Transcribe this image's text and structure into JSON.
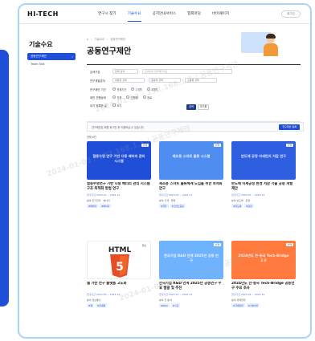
{
  "header": {
    "logo": "HI-TECH",
    "nav": [
      "연구시 찾기",
      "기술수요",
      "공지안내서비스",
      "협회마당",
      "바이패이지"
    ],
    "active_index": 1,
    "right_button": "로그인"
  },
  "sidebar": {
    "title": "기술수요",
    "items": [
      {
        "label": "공동연구제안"
      },
      {
        "label": "Team Talk"
      }
    ]
  },
  "breadcrumb": [
    "기술수요",
    "공동연구제안"
  ],
  "page_title": "공동연구제안",
  "search": {
    "rows": [
      {
        "label": "검색구분",
        "select": "전체 검색",
        "input_placeholder": "검색어를 입력해주세요"
      },
      {
        "label": "연구개발분야",
        "select": "대분류 선택",
        "select2": "중분류 선택",
        "select3": "소분류 선택"
      },
      {
        "label": "연구제안 기간",
        "radios": [
          "전체기간",
          "1개월",
          "3개월"
        ]
      },
      {
        "label": "제안 진행상태",
        "radios": [
          "전체",
          "진행중",
          "완료"
        ]
      },
      {
        "label": "내가 등록한 글",
        "checkbox": "보기"
      }
    ],
    "search_button": "검색",
    "reset_button": "초기화"
  },
  "notice": {
    "text": "연구제안은 회원 로그인 후 이용하실 수 있습니다.",
    "write_button": "연구제안 등록"
  },
  "count_text": "전체 6건",
  "cards": [
    {
      "thumb_text": "협동수명 연구 기반 다중 배터리 관리 시스템",
      "thumb_color": "#1f4fd8",
      "tag": "진행",
      "title": "협동수명연구 기반 다중 배터리 관리 시스템 구조 최적화 방법 연구",
      "meta": [
        "연구기간 2024.01 ~ 2024.12",
        "분야 전기전자 · 에너지"
      ],
      "chips": [
        "#배터리",
        "#에너지"
      ]
    },
    {
      "thumb_text": "제조용 스마트 물류 시스템",
      "thumb_color": "#4f8ef0",
      "tag": "진행",
      "title": "제조용 스마트 물류체계 도입을 위한 최적화 연구",
      "meta": [
        "연구기간 2024.02 ~ 2024.11",
        "분야 기계 · 물류"
      ],
      "chips": [
        "#물류",
        "#스마트공장"
      ]
    },
    {
      "thumb_text": "반도체 공정 미세먼지 저감 연구",
      "thumb_color": "#2e5fe0",
      "tag": "진행",
      "title": "반도체 미세공정 환경 저감 기술 공동 개발 제안",
      "meta": [
        "연구기간 2024.03 ~ 2024.12",
        "분야 반도체 · 환경"
      ],
      "chips": [
        "#반도체",
        "#공정"
      ]
    },
    {
      "thumb_text": "HTML 5",
      "thumb_color": "#ffffff",
      "tag": "완료",
      "title": "웹 기반 연구 플랫폼 고도화",
      "meta": [
        "연구기간 2023.05 ~ 2023.12",
        "분야 정보통신"
      ],
      "chips": [
        "#웹",
        "#플랫폼"
      ]
    },
    {
      "thumb_text": "한국기업 R&D 연계 2025년 공동 연구",
      "thumb_color": "#6fb3ff",
      "tag": "진행",
      "title": "한국기업 R&D 연계 2025년 공동연구 수요 발굴 및 추진",
      "meta": [
        "연구기간 2025.01 ~ 2025.12",
        "분야 전 분야"
      ],
      "chips": [
        "#R&D",
        "#수요"
      ]
    },
    {
      "thumb_text": "2024년도 한·중국 Tech-Bridge 2.0",
      "thumb_color": "#ff7a3c",
      "tag": "진행",
      "title": "2024년도 한·중국 Tech-Bridge 공동연구 수요 조사",
      "meta": [
        "연구기간 2024.04 ~ 2024.10",
        "분야 국제협력"
      ],
      "chips": [
        "#국제협력",
        "#기술이전"
      ]
    }
  ],
  "watermark": "2024-01-03 / 192.168.1.1 / 공동연구제안"
}
